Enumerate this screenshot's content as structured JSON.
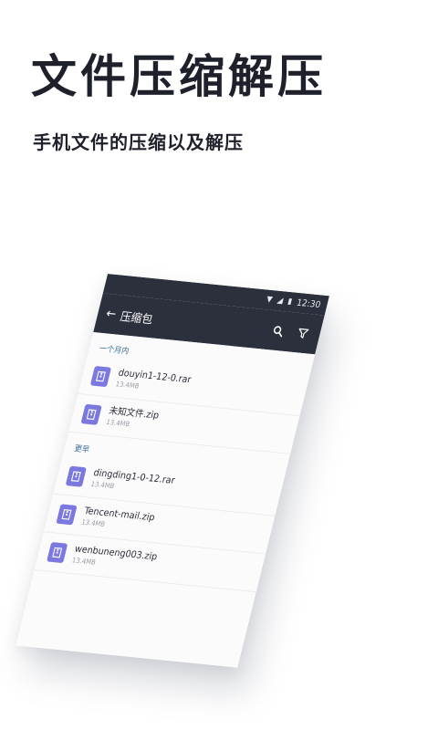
{
  "hero": {
    "title": "文件压缩解压",
    "subtitle": "手机文件的压缩以及解压"
  },
  "status_bar": {
    "time": "12:30"
  },
  "app_bar": {
    "back_icon": "arrow-left-icon",
    "title": "压缩包",
    "search_icon": "search-icon",
    "filter_icon": "filter-icon"
  },
  "sections": [
    {
      "header": "一个月内",
      "files": [
        {
          "name": "douyin1-12-0.rar",
          "size": "13.4MB"
        },
        {
          "name": "未知文件.zip",
          "size": "13.4MB"
        }
      ]
    },
    {
      "header": "更早",
      "files": [
        {
          "name": "dingding1-0-12.rar",
          "size": "13.4MB"
        },
        {
          "name": "Tencent-mail.zip",
          "size": "13.4MB"
        },
        {
          "name": "wenbuneng003.zip",
          "size": "13.4MB"
        }
      ]
    }
  ],
  "colors": {
    "bar": "#2c303d",
    "file_icon": "#7b78df",
    "section_header": "#3a6f9a"
  }
}
